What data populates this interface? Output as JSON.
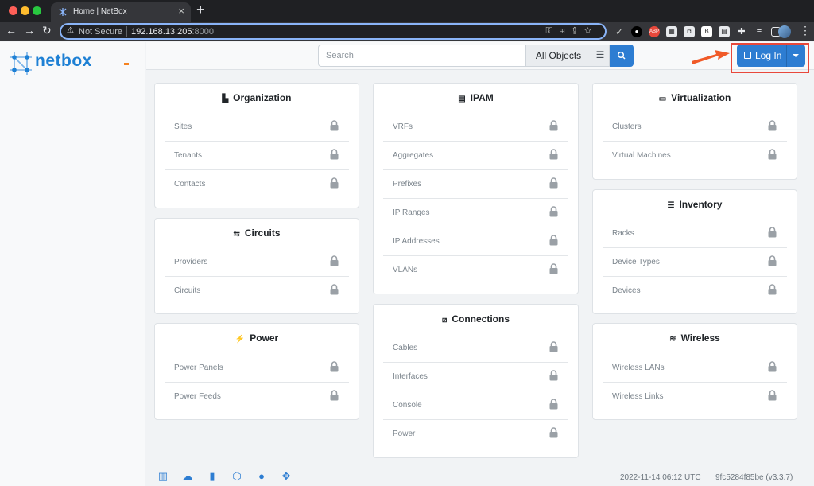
{
  "browser": {
    "tab_title": "Home | NetBox",
    "tab_close": "×",
    "new_tab": "+",
    "url_warning": "Not Secure",
    "url_host": "192.168.13.205",
    "url_port": ":8000",
    "nav": {
      "back": "←",
      "forward": "→",
      "reload": "↻"
    },
    "menu": "⋮"
  },
  "app": {
    "logo_text": "netbox",
    "search_placeholder": "Search",
    "object_filter": "All Objects",
    "login_label": "Log In"
  },
  "cards": {
    "organization": {
      "title": "Organization",
      "items": [
        "Sites",
        "Tenants",
        "Contacts"
      ]
    },
    "circuits": {
      "title": "Circuits",
      "items": [
        "Providers",
        "Circuits"
      ]
    },
    "power": {
      "title": "Power",
      "items": [
        "Power Panels",
        "Power Feeds"
      ]
    },
    "ipam": {
      "title": "IPAM",
      "items": [
        "VRFs",
        "Aggregates",
        "Prefixes",
        "IP Ranges",
        "IP Addresses",
        "VLANs"
      ]
    },
    "connections": {
      "title": "Connections",
      "items": [
        "Cables",
        "Interfaces",
        "Console",
        "Power"
      ]
    },
    "virtualization": {
      "title": "Virtualization",
      "items": [
        "Clusters",
        "Virtual Machines"
      ]
    },
    "inventory": {
      "title": "Inventory",
      "items": [
        "Racks",
        "Device Types",
        "Devices"
      ]
    },
    "wireless": {
      "title": "Wireless",
      "items": [
        "Wireless LANs",
        "Wireless Links"
      ]
    }
  },
  "footer": {
    "timestamp": "2022-11-14 06:12 UTC",
    "version": "9fc5284f85be (v3.3.7)"
  },
  "colors": {
    "accent": "#2d7dd2",
    "highlight": "#e8483b",
    "arrow": "#f05a28"
  }
}
